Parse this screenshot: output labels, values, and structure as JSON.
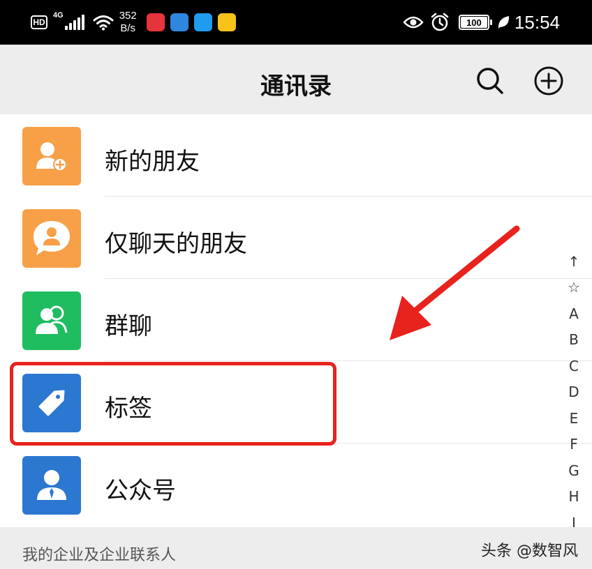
{
  "status_bar": {
    "hd_label": "HD",
    "network_label": "4G",
    "speed_value": "352",
    "speed_unit": "B/s",
    "battery_level": "100",
    "time": "15:54",
    "icons": [
      "signal-icon",
      "wifi-icon",
      "eye-icon",
      "alarm-icon",
      "battery-icon",
      "leaf-icon"
    ],
    "app_icon_colors": [
      "#e5343b",
      "#2e86de",
      "#1f9bf0",
      "#f8c21a"
    ]
  },
  "header": {
    "title": "通讯录",
    "actions": [
      "search-icon",
      "add-icon"
    ]
  },
  "contacts": [
    {
      "label": "新的朋友",
      "icon": "user-add-icon",
      "color": "#f7a048"
    },
    {
      "label": "仅聊天的朋友",
      "icon": "chat-user-icon",
      "color": "#f7a048"
    },
    {
      "label": "群聊",
      "icon": "group-icon",
      "color": "#1fbd60"
    },
    {
      "label": "标签",
      "icon": "tag-icon",
      "color": "#2c77d0"
    },
    {
      "label": "公众号",
      "icon": "official-account-icon",
      "color": "#2c77d0"
    }
  ],
  "index_bar": [
    "↑",
    "☆",
    "A",
    "B",
    "C",
    "D",
    "E",
    "F",
    "G",
    "H",
    "I"
  ],
  "footer": {
    "section_label": "我的企业及企业联系人",
    "watermark": "头条 @数智风"
  },
  "annotation": {
    "highlight_color": "#e8221c"
  }
}
